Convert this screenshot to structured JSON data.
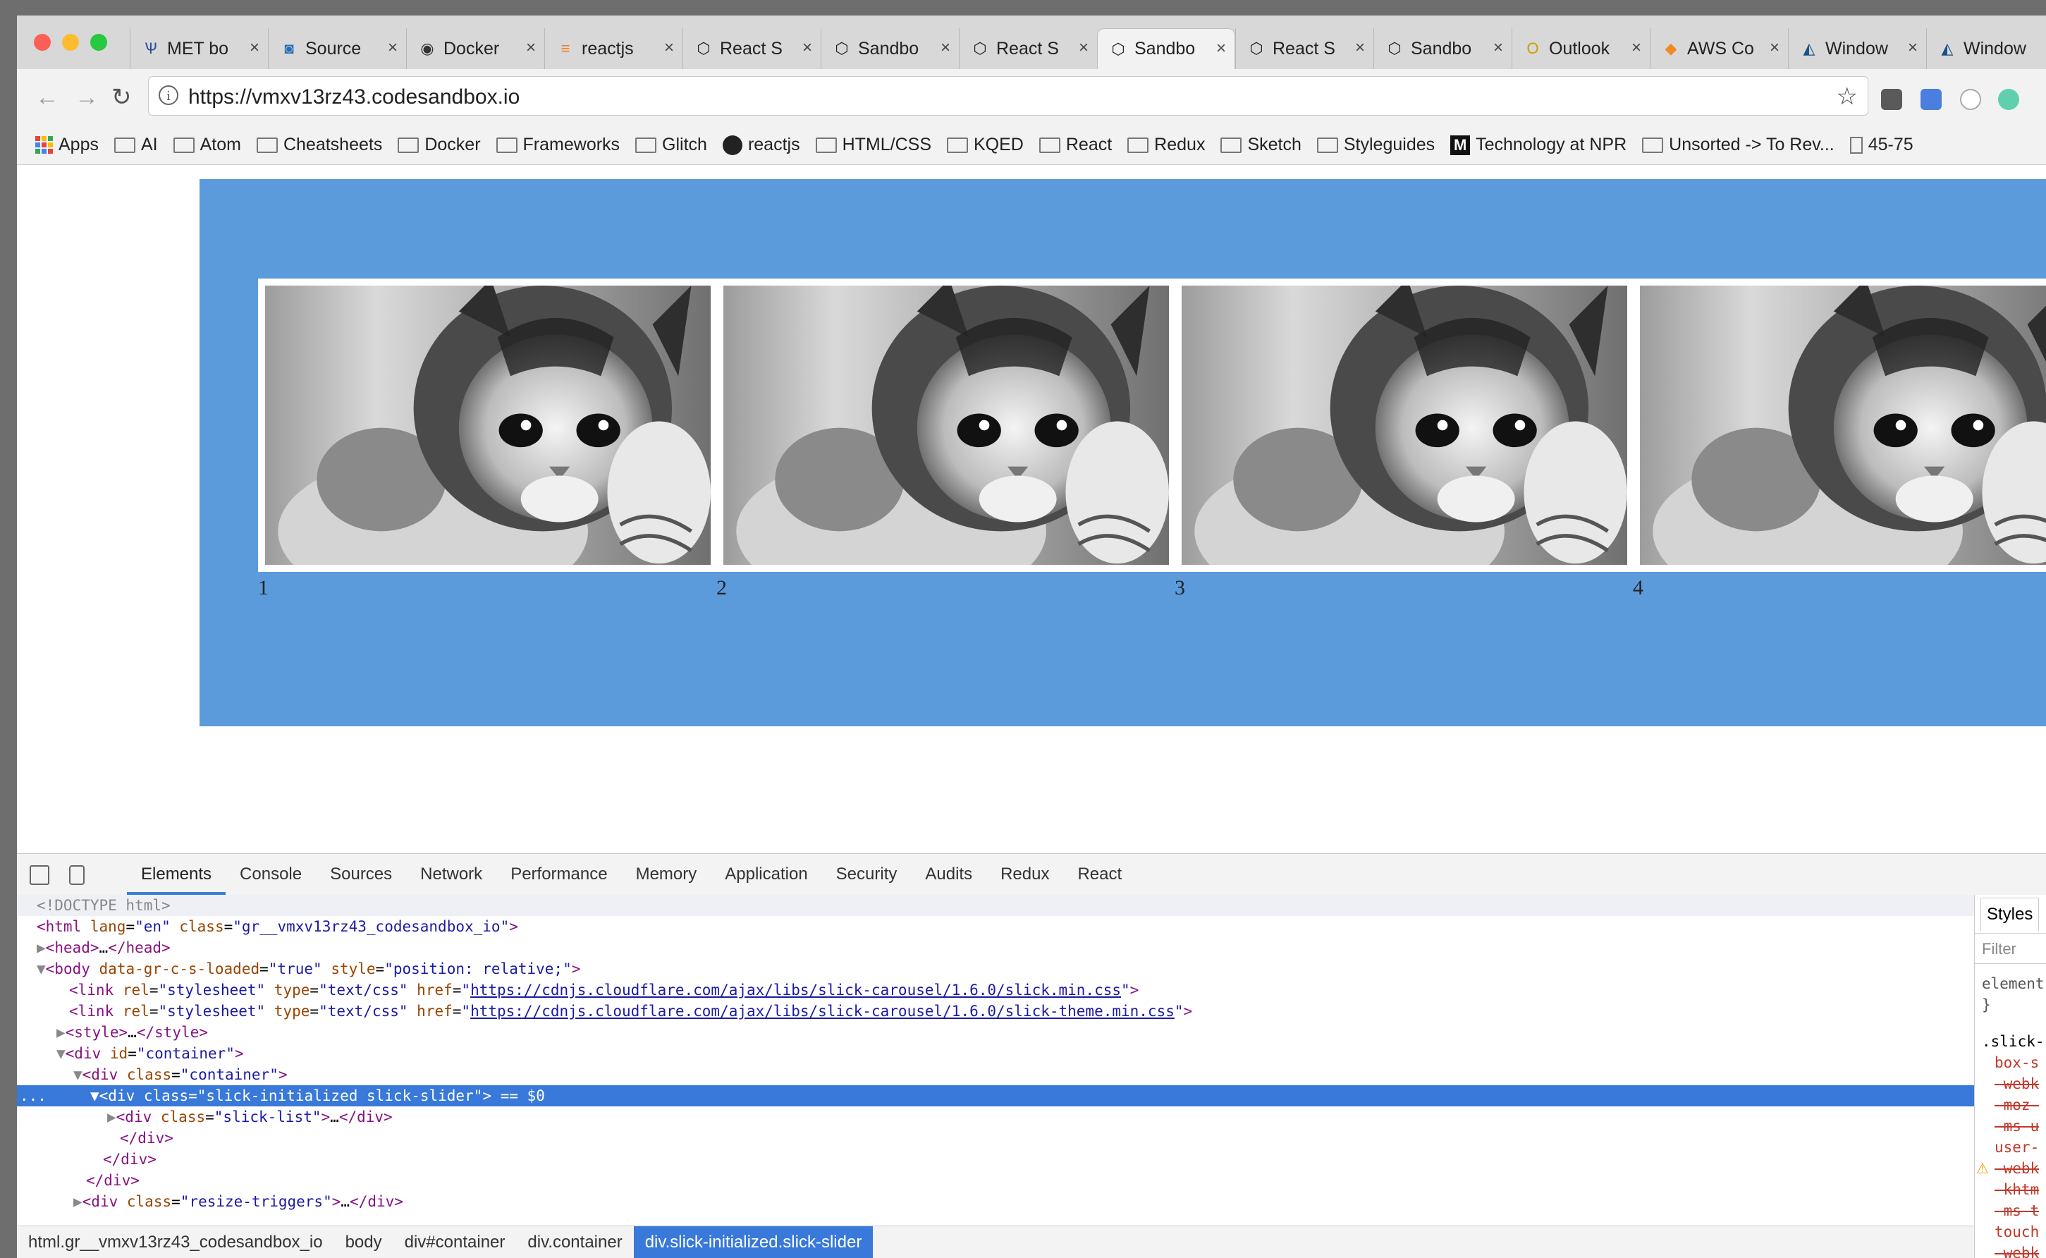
{
  "browser": {
    "tabs": [
      {
        "label": "MET bo",
        "icon": "fork-icon"
      },
      {
        "label": "Source",
        "icon": "source-icon"
      },
      {
        "label": "Docker",
        "icon": "github-icon"
      },
      {
        "label": "reactjs",
        "icon": "stackoverflow-icon"
      },
      {
        "label": "React S",
        "icon": "cube-icon"
      },
      {
        "label": "Sandbo",
        "icon": "cube-icon"
      },
      {
        "label": "React S",
        "icon": "cube-icon"
      },
      {
        "label": "Sandbo",
        "icon": "cube-icon",
        "active": true
      },
      {
        "label": "React S",
        "icon": "cube-icon"
      },
      {
        "label": "Sandbo",
        "icon": "cube-icon"
      },
      {
        "label": "Outlook",
        "icon": "outlook-icon"
      },
      {
        "label": "AWS Co",
        "icon": "aws-icon"
      },
      {
        "label": "Window",
        "icon": "bird-icon"
      },
      {
        "label": "Window",
        "icon": "bird-icon"
      }
    ],
    "url": "https://vmxv13rz43.codesandbox.io",
    "bookmarks": [
      {
        "label": "Apps",
        "type": "apps"
      },
      {
        "label": "AI",
        "type": "folder"
      },
      {
        "label": "Atom",
        "type": "folder"
      },
      {
        "label": "Cheatsheets",
        "type": "folder"
      },
      {
        "label": "Docker",
        "type": "folder"
      },
      {
        "label": "Frameworks",
        "type": "folder"
      },
      {
        "label": "Glitch",
        "type": "folder"
      },
      {
        "label": "reactjs",
        "type": "github"
      },
      {
        "label": "HTML/CSS",
        "type": "folder"
      },
      {
        "label": "KQED",
        "type": "folder"
      },
      {
        "label": "React",
        "type": "folder"
      },
      {
        "label": "Redux",
        "type": "folder"
      },
      {
        "label": "Sketch",
        "type": "folder"
      },
      {
        "label": "Styleguides",
        "type": "folder"
      },
      {
        "label": "Technology at NPR",
        "type": "medium"
      },
      {
        "label": "Unsorted -> To Rev...",
        "type": "folder"
      },
      {
        "label": "45-75",
        "type": "page"
      }
    ]
  },
  "page": {
    "banner_color": "#5b9bdc",
    "slides": [
      {
        "number": "1"
      },
      {
        "number": "2"
      },
      {
        "number": "3"
      },
      {
        "number": "4"
      }
    ]
  },
  "devtools": {
    "tabs": [
      "Elements",
      "Console",
      "Sources",
      "Network",
      "Performance",
      "Memory",
      "Application",
      "Security",
      "Audits",
      "Redux",
      "React"
    ],
    "active_tab": "Elements",
    "dom": {
      "doctype": "<!DOCTYPE html>",
      "html_lang": "en",
      "html_class": "gr__vmxv13rz43_codesandbox_io",
      "head": "head",
      "body_gr": "true",
      "body_style": "position: relative;",
      "link1_href": "https://cdnjs.cloudflare.com/ajax/libs/slick-carousel/1.6.0/slick.min.css",
      "link2_href": "https://cdnjs.cloudflare.com/ajax/libs/slick-carousel/1.6.0/slick-theme.min.css",
      "container_id": "container",
      "container_class": "container",
      "slider_class": "slick-initialized slick-slider",
      "selected_marker": "== $0",
      "list_class": "slick-list",
      "resize_class": "resize-triggers",
      "row_dots": "..."
    },
    "breadcrumbs": [
      "html.gr__vmxv13rz43_codesandbox_io",
      "body",
      "div#container",
      "div.container",
      "div.slick-initialized.slick-slider"
    ],
    "styles": {
      "tab": "Styles",
      "filter_placeholder": "Filter",
      "lines": [
        "element",
        "}",
        ".slick-",
        "box-s",
        "-webk",
        "-moz-",
        "-ms-u",
        "user-",
        "-webk",
        "-khtm",
        "-ms-t",
        "touch",
        "-webk"
      ]
    }
  }
}
